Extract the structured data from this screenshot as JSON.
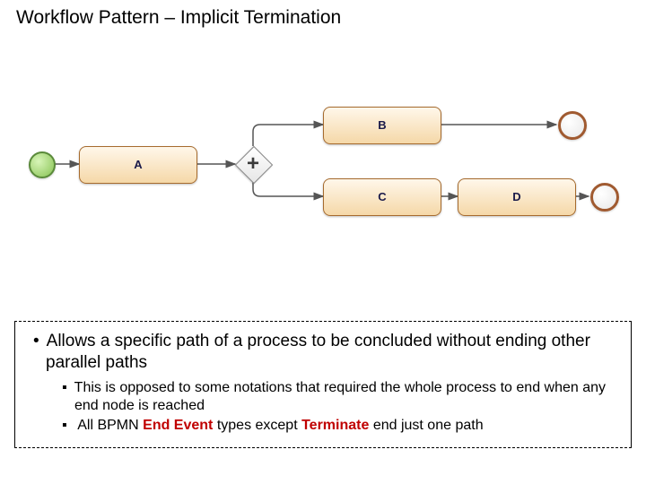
{
  "title": "Workflow Pattern – Implicit Termination",
  "diagram": {
    "start_event_name": "start-event",
    "tasks": {
      "A": "A",
      "B": "B",
      "C": "C",
      "D": "D"
    },
    "gateway": {
      "type": "parallel",
      "symbol": "+"
    },
    "end_event_1_name": "end-event",
    "end_event_2_name": "end-event"
  },
  "bullets": {
    "l1": "Allows a specific path of a process to be concluded without ending other parallel paths",
    "l2a_pre": "This is opposed to some notations that required the whole process to end when any end node is reached",
    "l2b_pre": "All BPMN ",
    "l2b_red1": "End Event",
    "l2b_mid": " types except ",
    "l2b_red2": "Terminate",
    "l2b_post": " end just one path"
  },
  "chart_data": {
    "type": "bpmn-diagram",
    "title": "Workflow Pattern – Implicit Termination",
    "nodes": [
      {
        "id": "start",
        "type": "startEvent"
      },
      {
        "id": "A",
        "type": "task",
        "label": "A"
      },
      {
        "id": "gw",
        "type": "parallelGateway",
        "marker": "+"
      },
      {
        "id": "B",
        "type": "task",
        "label": "B"
      },
      {
        "id": "C",
        "type": "task",
        "label": "C"
      },
      {
        "id": "D",
        "type": "task",
        "label": "D"
      },
      {
        "id": "end1",
        "type": "endEvent"
      },
      {
        "id": "end2",
        "type": "endEvent"
      }
    ],
    "edges": [
      {
        "from": "start",
        "to": "A"
      },
      {
        "from": "A",
        "to": "gw"
      },
      {
        "from": "gw",
        "to": "B"
      },
      {
        "from": "gw",
        "to": "C"
      },
      {
        "from": "B",
        "to": "end1"
      },
      {
        "from": "C",
        "to": "D"
      },
      {
        "from": "D",
        "to": "end2"
      }
    ]
  }
}
